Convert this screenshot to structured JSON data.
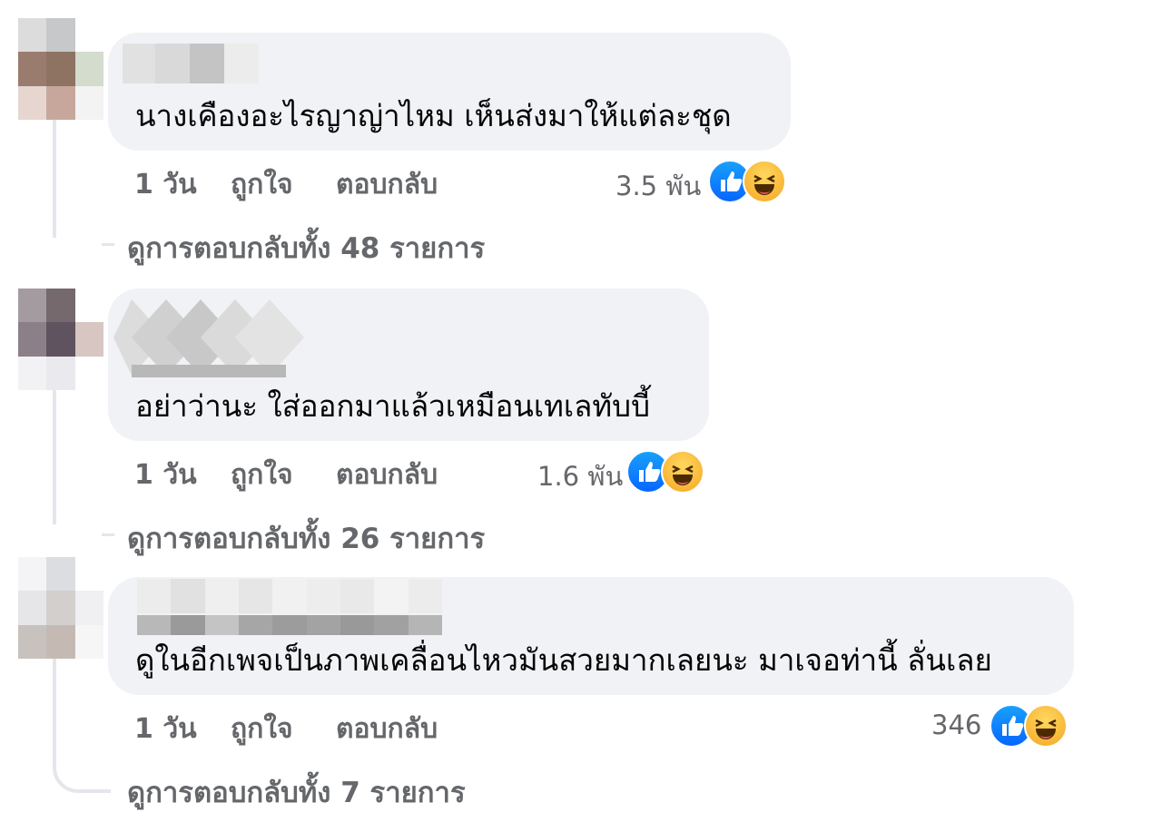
{
  "comments": [
    {
      "text": "นางเคืองอะไรญาญ่าไหม เห็นส่งมาให้แต่ละชุด",
      "time": "1 วัน",
      "like_label": "ถูกใจ",
      "reply_label": "ตอบกลับ",
      "reaction_count": "3.5 พัน",
      "reactions": [
        "like-icon",
        "haha-icon"
      ],
      "view_replies": "ดูการตอบกลับทั้ง 48 รายการ"
    },
    {
      "text": "อย่าว่านะ ใส่ออกมาแล้วเหมือนเทเลทับบี้",
      "time": "1 วัน",
      "like_label": "ถูกใจ",
      "reply_label": "ตอบกลับ",
      "reaction_count": "1.6 พัน",
      "reactions": [
        "like-icon",
        "haha-icon"
      ],
      "view_replies": "ดูการตอบกลับทั้ง 26 รายการ"
    },
    {
      "text": "ดูในอีกเพจเป็นภาพเคลื่อนไหวมันสวยมากเลยนะ มาเจอท่านี้ ลั่นเลย",
      "time": "1 วัน",
      "like_label": "ถูกใจ",
      "reply_label": "ตอบกลับ",
      "reaction_count": "346",
      "reactions": [
        "like-icon",
        "haha-icon"
      ],
      "view_replies": "ดูการตอบกลับทั้ง 7 รายการ"
    }
  ],
  "colors": {
    "bubble": "#f0f2f5",
    "secondary_text": "#65676b",
    "like_blue": "#0866ff",
    "haha_yellow": "#f7b928"
  }
}
